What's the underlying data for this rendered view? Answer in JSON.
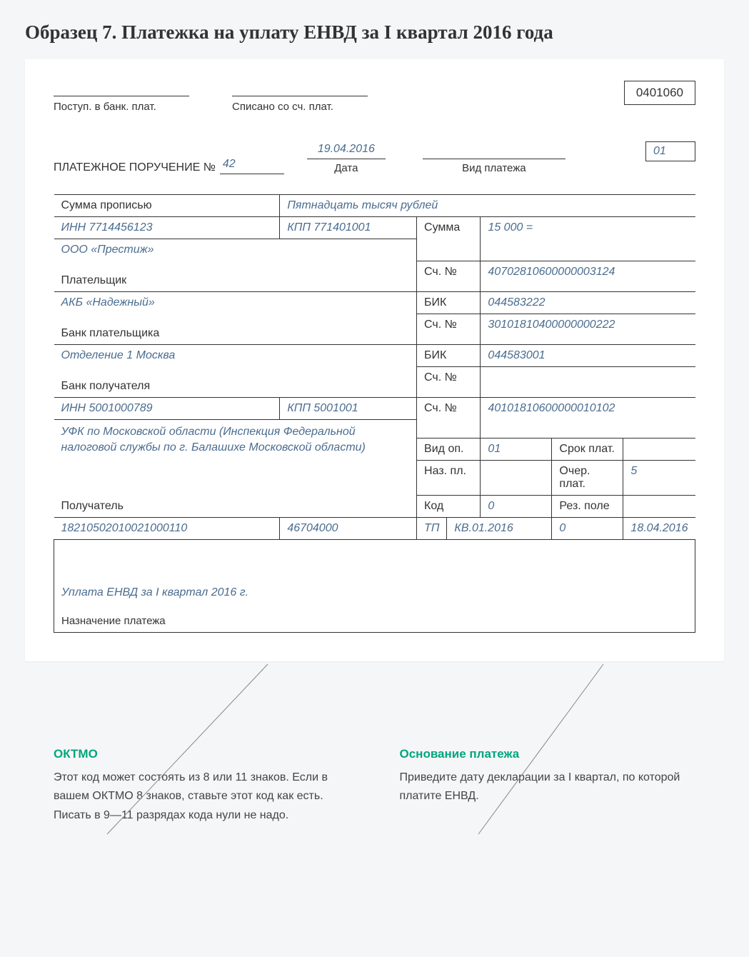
{
  "title": "Образец 7. Платежка на уплату ЕНВД за I квартал 2016 года",
  "form_code": "0401060",
  "top": {
    "bank_in_label": "Поступ. в банк. плат.",
    "written_off_label": "Списано со сч. плат."
  },
  "order": {
    "label_prefix": "ПЛАТЕЖНОЕ ПОРУЧЕНИЕ №",
    "number": "42",
    "date": "19.04.2016",
    "date_label": "Дата",
    "payment_type_label": "Вид платежа",
    "status": "01"
  },
  "sum_words": {
    "label": "Сумма прописью",
    "value": "Пятнадцать тысяч рублей"
  },
  "payer": {
    "inn": "ИНН 7714456123",
    "kpp": "КПП 771401001",
    "sum_label": "Сумма",
    "sum_value": "15 000 =",
    "name": "ООО «Престиж»",
    "acc_label": "Сч. №",
    "acc_value": "40702810600000003124",
    "row_label": "Плательщик"
  },
  "payer_bank": {
    "name": "АКБ «Надежный»",
    "bik_label": "БИК",
    "bik_value": "044583222",
    "acc_label": "Сч. №",
    "acc_value": "30101810400000000222",
    "row_label": "Банк плательщика"
  },
  "recip_bank": {
    "name": "Отделение 1 Москва",
    "bik_label": "БИК",
    "bik_value": "044583001",
    "acc_label": "Сч. №",
    "row_label": "Банк получателя"
  },
  "recipient": {
    "inn": "ИНН 5001000789",
    "kpp": "КПП 5001001",
    "acc_label": "Сч. №",
    "acc_value": "40101810600000010102",
    "name": "УФК по Московской области (Инспекция Федеральной налоговой службы по г. Балашихе Московской области)",
    "row_label": "Получатель",
    "vid_op_label": "Вид оп.",
    "vid_op_value": "01",
    "srok_label": "Срок плат.",
    "naz_pl_label": "Наз. пл.",
    "ocher_label": "Очер. плат.",
    "ocher_value": "5",
    "kod_label": "Код",
    "kod_value": "0",
    "rez_label": "Рез. поле"
  },
  "codes": {
    "kbk": "18210502010021000110",
    "oktmo": "46704000",
    "tp": "ТП",
    "period": "КВ.01.2016",
    "doc_no": "0",
    "doc_date": "18.04.2016"
  },
  "purpose": {
    "value": "Уплата ЕНВД за I квартал 2016 г.",
    "label": "Назначение платежа"
  },
  "anno1": {
    "title": "ОКТМО",
    "text": "Этот код может состоять из 8 или 11 знаков. Если в вашем ОКТМО 8 знаков, ставьте этот код как есть. Писать в 9—11 разрядах кода нули не надо."
  },
  "anno2": {
    "title": "Основание платежа",
    "text": "Приведите дату декларации за I квартал, по которой платите ЕНВД."
  }
}
